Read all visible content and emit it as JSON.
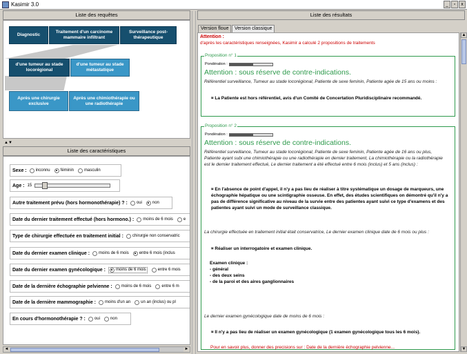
{
  "window": {
    "title": "Kasimir 3.0",
    "buttons": [
      "_",
      "▫",
      "x"
    ]
  },
  "requests_panel": {
    "header": "Liste des requêtes",
    "row1": [
      "Diagnostic",
      "Traitement d'un carcinome mammaire infiltrant",
      "Surveillance post-thérapeutique"
    ],
    "row2": [
      "d'une tumeur au stade locorégional",
      "d'une tumeur au stade métastatique"
    ],
    "row3": [
      "Après une chirurgie exclusive",
      "Après une chimiothérapie ou une radiothérapie"
    ],
    "colors": {
      "dark": "#1c5b7d",
      "light": "#3a97c7"
    }
  },
  "characteristics_panel": {
    "header": "Liste des caractéristiques",
    "sexe": {
      "label": "Sexe :",
      "options": [
        "inconnu",
        "féminin",
        "masculin"
      ],
      "selected": "féminin"
    },
    "age": {
      "label": "Age :",
      "value": "15"
    },
    "autre_traitement": {
      "label": "Autre traitement prévu (hors hormonothérapie) ? :",
      "options": [
        "oui",
        "non"
      ],
      "selected": "non"
    },
    "date_dernier_traitement": {
      "label": "Date du dernier traitement effectué (hors hormono.) :",
      "options": [
        "moins de 6 mois",
        "e"
      ]
    },
    "type_chirurgie": {
      "label": "Type de chirurgie effectuée en traitement initial :",
      "options": [
        "chirurgie non conservatric"
      ]
    },
    "date_examen_clinique": {
      "label": "Date du dernier examen clinique :",
      "options": [
        "moins de 6 mois",
        "entre 6 mois (inclus"
      ],
      "selected": "entre 6 mois (inclus"
    },
    "date_examen_gyneco": {
      "label": "Date du dernier examen gynécologique :",
      "options": [
        "moins de 6 mois",
        "entre 6 mois"
      ],
      "selected": "moins de 6 mois"
    },
    "date_echographie": {
      "label": "Date de la dernière échographie pelvienne :",
      "options": [
        "moins de 6 mois",
        "entre 6 m"
      ]
    },
    "date_mammographie": {
      "label": "Date de la dernière mammographie :",
      "options": [
        "moins d'un an",
        "un an (inclus) ou pl"
      ]
    },
    "hormonotherapie": {
      "label": "En cours d'hormonothérapie ? :",
      "options": [
        "oui",
        "non"
      ]
    }
  },
  "results_panel": {
    "header": "Liste des résultats",
    "tabs": [
      "Version floue",
      "Version classique"
    ],
    "attention_title": "Attention :",
    "attention_text": "d'après les caractéristiques renseignées, Kasimir a calculé 2 propositions de traitements",
    "ponderation_label": "Pondération :",
    "propositions": [
      {
        "legend": "Proposition n° 1",
        "ponderation": 0.55,
        "warning": "Attention : sous réserve de contre-indications.",
        "context": "Référentiel surveillance, Tumeur au stade locorégional, Patiente de sexe feminin, Patiente agée de 15 ans ou moins :",
        "recommendation": "¤ La Patiente est hors référentiel, avis d'un Comité de Concertation Pluridisciplinaire recommandé."
      },
      {
        "legend": "Proposition n° 2",
        "ponderation": 0.55,
        "warning": "Attention : sous réserve de contre-indications.",
        "context": "Référentiel surveillance, Tumeur au stade locorégional, Patiente de sexe feminin, Patiente agée de 16 ans ou plus, Patiente ayant subi une chimiothérapie ou une radiothérapie en dernier traitement, La chimiothérapie ou la radiothérapie est le dernier traitement effectué, Le dernier traitement a été effectué entre 6 mois (inclus) et 5 ans (inclus) :",
        "rec1": "¤ En l'absence de point d'appel, il n'y a pas lieu de réaliser à titre systématique un dosage de marqueurs, une échographie hépatique ou une scintigraphie osseuse. En effet, des études scientifiques on démontré qu'il n'y a pas de différence significative au niveau de la survie entre des patientes ayant suivi ce type d'examens et des patientes ayant suivi un mode de surveillance classique.",
        "context2": "La chirurgie effectuée en traitement initial était conservatrice, Le dernier examen clinique date de 6 mois ou plus :",
        "rec2": "¤ Réaliser un interrogatoire et examen clinique.",
        "exam_title": "Examen clinique :",
        "exam_items": [
          "- général",
          "- des deux seins",
          "- de la paroi et des aires ganglionnaires"
        ],
        "context3": "Le dernier examen gynécologique date de moins de 6 mois :",
        "rec3": "¤ Il n'y a pas lieu de réaliser un examen gynécologique (1 examen gynécologique tous les 6 mois)."
      }
    ],
    "more_text": "Pour en savoir plus, donner des precisions sur : Date de la dernière échographie pelvienne..."
  }
}
